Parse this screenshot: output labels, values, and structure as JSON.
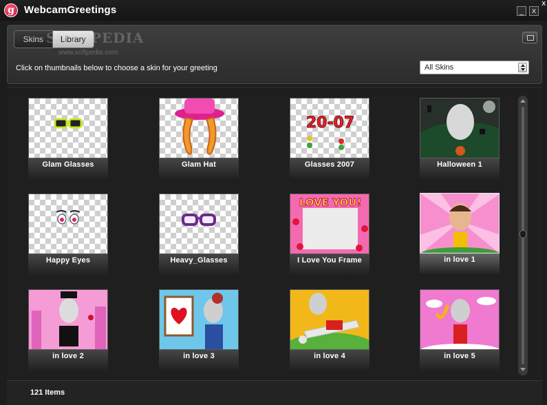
{
  "window": {
    "title": "WebcamGreetings",
    "logo_letter": "g",
    "min_symbol": "_",
    "close_symbol": "x",
    "corner_symbol": "x"
  },
  "toolbar": {
    "tabs": [
      {
        "label": "Skins",
        "active": false
      },
      {
        "label": "Library",
        "active": true
      }
    ],
    "watermark": "SOFTPEDIA",
    "watermark_url": "www.softpedia.com"
  },
  "instruction": "Click on thumbnails below to choose  a skin for your greeting",
  "filter": {
    "selected": "All Skins"
  },
  "thumbnails": [
    {
      "label": "Glam Glasses"
    },
    {
      "label": "Glam Hat"
    },
    {
      "label": "Glasses 2007",
      "overlay_text": "20-07"
    },
    {
      "label": "Halloween 1"
    },
    {
      "label": "Happy Eyes"
    },
    {
      "label": "Heavy_Glasses"
    },
    {
      "label": "I Love You Frame",
      "overlay_text": "LOVE YOU!"
    },
    {
      "label": "in love 1",
      "selected": true
    },
    {
      "label": "in love 2"
    },
    {
      "label": "in love 3"
    },
    {
      "label": "in love 4"
    },
    {
      "label": "in love 5"
    }
  ],
  "status": {
    "item_count": "121 Items"
  },
  "colors": {
    "background": "#1d1d1d",
    "panel": "#333333",
    "text": "#ffffff",
    "logo": "#d81a4a"
  }
}
